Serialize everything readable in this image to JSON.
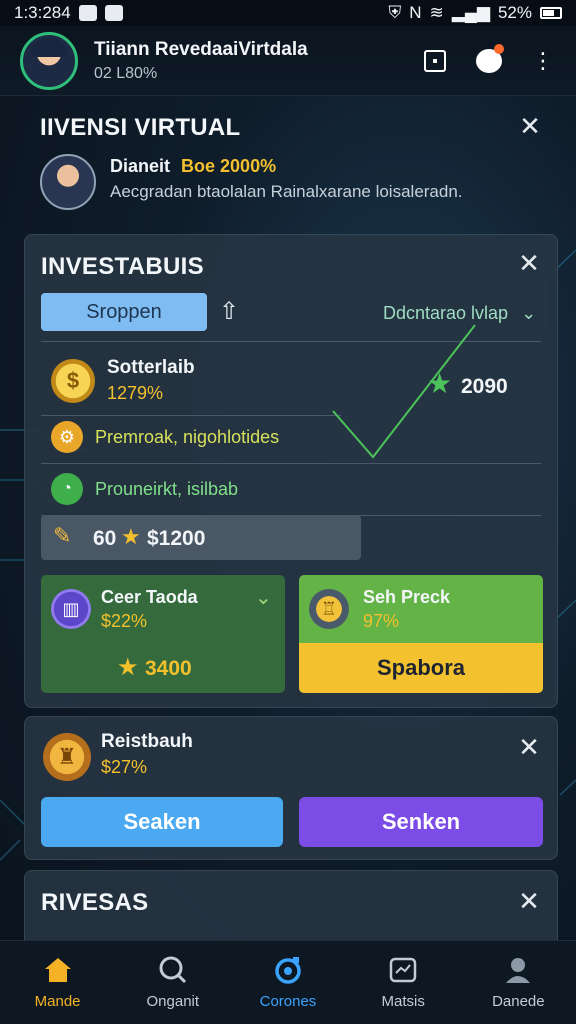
{
  "status": {
    "time": "1:3:284",
    "battery": "52%"
  },
  "header": {
    "title": "Tiiann RevedaaiVirtdala",
    "subtitle": "02 L80%"
  },
  "card1": {
    "title": "IIVENSI VIRTUAL",
    "line1_prefix": "Dianeit",
    "line1_highlight": "Boe 2000%",
    "line2": "Aecgradan btaolalan Rainalxarane loisaleradn."
  },
  "card2": {
    "title": "INVESTABUIS",
    "tab_label": "Sroppen",
    "dropdown_label": "Ddcntarao lvlap",
    "asset_name": "Sotterlaib",
    "asset_percent": "1279%",
    "chart_value": "2090",
    "row2_label": "Premroak, nigohlotides",
    "row3_label": "Prouneirkt, isilbab",
    "amount_prefix": "60",
    "amount_value": "$1200",
    "sub_left": {
      "name": "Ceer Taoda",
      "percent": "$22%",
      "value": "3400"
    },
    "sub_right": {
      "name": "Seh Preck",
      "percent": "97%",
      "button": "Spabora"
    }
  },
  "card3": {
    "name": "Reistbauh",
    "percent": "$27%",
    "btn_left": "Seaken",
    "btn_right": "Senken"
  },
  "card4": {
    "title": "RIVESAS"
  },
  "nav": [
    {
      "label": "Mande",
      "icon": "home-icon",
      "color": "#f5b224"
    },
    {
      "label": "Onganit",
      "icon": "search-icon",
      "color": "#c3ccd5"
    },
    {
      "label": "Corones",
      "icon": "coins-icon",
      "color": "#3aa3ff"
    },
    {
      "label": "Matsis",
      "icon": "chart-icon",
      "color": "#c3ccd5"
    },
    {
      "label": "Danede",
      "icon": "profile-icon",
      "color": "#c3ccd5"
    }
  ],
  "colors": {
    "accent_green": "#4cc35a",
    "accent_gold": "#f2c02d",
    "accent_blue": "#4aa9f0",
    "accent_purple": "#7b4ce6"
  }
}
